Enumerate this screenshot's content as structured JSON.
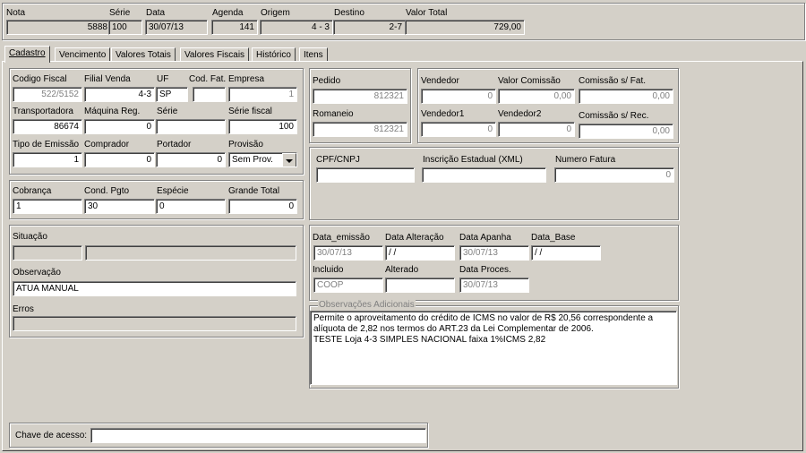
{
  "header": {
    "nota_label": "Nota",
    "nota_value": "5888",
    "serie_label": "Série",
    "serie_value": "100",
    "data_label": "Data",
    "data_value": "30/07/13",
    "agenda_label": "Agenda",
    "agenda_value": "141",
    "origem_label": "Origem",
    "origem_value": "4 - 3",
    "destino_label": "Destino",
    "destino_value": "2-7",
    "valor_total_label": "Valor Total",
    "valor_total_value": "729,00"
  },
  "tabs": [
    {
      "label": "Cadastro"
    },
    {
      "label": "Vencimento"
    },
    {
      "label": "Valores Totais"
    },
    {
      "label": "Valores Fiscais"
    },
    {
      "label": "Histórico"
    },
    {
      "label": "Itens"
    }
  ],
  "cadastro": {
    "codigo_fiscal_label": "Codigo Fiscal",
    "codigo_fiscal_value": "522/5152",
    "filial_venda_label": "Filial Venda",
    "filial_venda_value": "4-3",
    "uf_label": "UF",
    "uf_value": "SP",
    "cod_fat_label": "Cod. Fat.",
    "cod_fat_value": "",
    "empresa_label": "Empresa",
    "empresa_value": "1",
    "transportadora_label": "Transportadora",
    "transportadora_value": "86674",
    "maquina_reg_label": "Máquina Reg.",
    "maquina_reg_value": "0",
    "serie_label": "Série",
    "serie_value": "",
    "serie_fiscal_label": "Série fiscal",
    "serie_fiscal_value": "100",
    "tipo_emissao_label": "Tipo de Emissão",
    "tipo_emissao_value": "1",
    "comprador_label": "Comprador",
    "comprador_value": "0",
    "portador_label": "Portador",
    "portador_value": "0",
    "provisao_label": "Provisão",
    "provisao_value": "Sem Prov.",
    "cobranca_label": "Cobrança",
    "cobranca_value": "1",
    "cond_pgto_label": "Cond. Pgto",
    "cond_pgto_value": "30",
    "especie_label": "Espécie",
    "especie_value": "0",
    "grande_total_label": "Grande Total",
    "grande_total_value": "0",
    "situacao_label": "Situação",
    "situacao_code": "",
    "situacao_desc": "",
    "observacao_label": "Observação",
    "observacao_value": "ATUA MANUAL",
    "erros_label": "Erros",
    "erros_value": "",
    "pedido_label": "Pedido",
    "pedido_value": "812321",
    "romaneio_label": "Romaneio",
    "romaneio_value": "812321",
    "vendedor_label": "Vendedor",
    "vendedor_value": "0",
    "valor_comissao_label": "Valor Comissão",
    "valor_comissao_value": "0,00",
    "comissao_fat_label": "Comissão s/ Fat.",
    "comissao_fat_value": "0,00",
    "vendedor1_label": "Vendedor1",
    "vendedor1_value": "0",
    "vendedor2_label": "Vendedor2",
    "vendedor2_value": "0",
    "comissao_rec_label": "Comissão s/ Rec.",
    "comissao_rec_value": "0,00",
    "cpf_cnpj_label": "CPF/CNPJ",
    "cpf_cnpj_value": "",
    "inscricao_label": "Inscrição Estadual (XML)",
    "inscricao_value": "",
    "numero_fatura_label": "Numero Fatura",
    "numero_fatura_value": "0",
    "data_emissao_label": "Data_emissão",
    "data_emissao_value": "30/07/13",
    "data_alteracao_label": "Data Alteração",
    "data_alteracao_value": " / /",
    "data_apanha_label": "Data Apanha",
    "data_apanha_value": "30/07/13",
    "data_base_label": "Data_Base",
    "data_base_value": " / /",
    "incluido_label": "Incluido",
    "incluido_value": "COOP",
    "alterado_label": "Alterado",
    "alterado_value": "",
    "data_proces_label": "Data Proces.",
    "data_proces_value": "30/07/13",
    "obs_adicionais_label": "Observações Adicionais",
    "obs_adicionais_line1": "Permite o aproveitamento do crédito de ICMS no valor de R$ 20,56 correspondente a",
    "obs_adicionais_line2": "alíquota de 2,82 nos termos do ART.23 da Lei Complementar de 2006.",
    "obs_adicionais_line3": "TESTE Loja 4-3 SIMPLES NACIONAL faixa 1%ICMS 2,82",
    "chave_acesso_label": "Chave de acesso:",
    "chave_acesso_value": ""
  }
}
